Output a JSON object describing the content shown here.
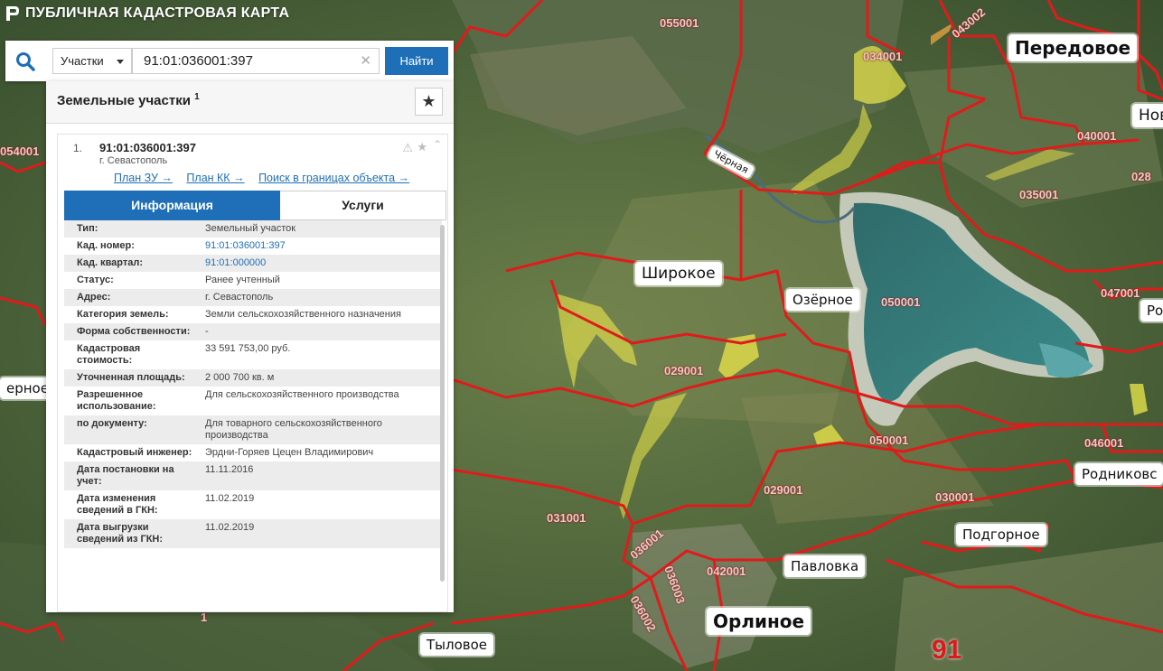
{
  "app": {
    "title": "ПУБЛИЧНАЯ КАДАСТРОВАЯ КАРТА"
  },
  "search": {
    "type_label": "Участки",
    "query": "91:01:036001:397",
    "button_label": "Найти"
  },
  "panel": {
    "title": "Земельные участки",
    "count": "1",
    "result": {
      "index": "1.",
      "id": "91:01:036001:397",
      "location": "г. Севастополь",
      "links": [
        "План ЗУ →",
        "План КК →",
        "Поиск в границах объекта →"
      ]
    },
    "tabs": {
      "info": "Информация",
      "services": "Услуги"
    },
    "rows": [
      {
        "k": "Тип:",
        "v": "Земельный участок"
      },
      {
        "k": "Кад. номер:",
        "v": "91:01:036001:397"
      },
      {
        "k": "Кад. квартал:",
        "v": "91:01:000000"
      },
      {
        "k": "Статус:",
        "v": "Ранее учтенный"
      },
      {
        "k": "Адрес:",
        "v": "г. Севастополь"
      },
      {
        "k": "Категория земель:",
        "v": "Земли сельскохозяйственного назначения"
      },
      {
        "k": "Форма собственности:",
        "v": "-"
      },
      {
        "k": "Кадастровая стоимость:",
        "v": "33 591 753,00 руб."
      },
      {
        "k": "Уточненная площадь:",
        "v": "2 000 700 кв. м"
      },
      {
        "k": "Разрешенное использование:",
        "v": "Для сельскохозяйственного производства"
      },
      {
        "k": "по документу:",
        "v": "Для товарного сельскохозяйственного производства"
      },
      {
        "k": "Кадастровый инженер:",
        "v": "Эрдни-Горяев Цецен Владимирович"
      },
      {
        "k": "Дата постановки на учет:",
        "v": "11.11.2016"
      },
      {
        "k": "Дата изменения сведений в ГКН:",
        "v": "11.02.2019"
      },
      {
        "k": "Дата выгрузки сведений из ГКН:",
        "v": "11.02.2019"
      }
    ]
  },
  "places": {
    "peredovoe": "Передовое",
    "shirokoe": "Широкое",
    "ozernoe": "Озёрное",
    "pavlovka": "Павловка",
    "orlinoe": "Орлиное",
    "tylovoe": "Тыловое",
    "podgornoe": "Подгорное",
    "rodnikovskoe": "Родниковс",
    "nov": "Нов",
    "ros": "Рос",
    "vernoe": "ерное",
    "river": "Чёрная"
  },
  "codes": {
    "c055001": "055001",
    "c034001": "034001",
    "c043002": "043002",
    "c040001": "040001",
    "c035001": "035001",
    "c054001": "054001",
    "c050001": "050001",
    "c047001": "047001",
    "c028": "028",
    "c029001a": "029001",
    "c029001b": "029001",
    "c030001": "030001",
    "c046001": "046001",
    "c031001": "031001",
    "c036001": "036001",
    "c042001": "042001",
    "c036003": "036003",
    "c036002": "036002",
    "c_x": "1",
    "region": "91"
  },
  "colors": {
    "boundary": "#e01b1b",
    "selected": "#e3e04a",
    "accent": "#1e6fb8"
  }
}
